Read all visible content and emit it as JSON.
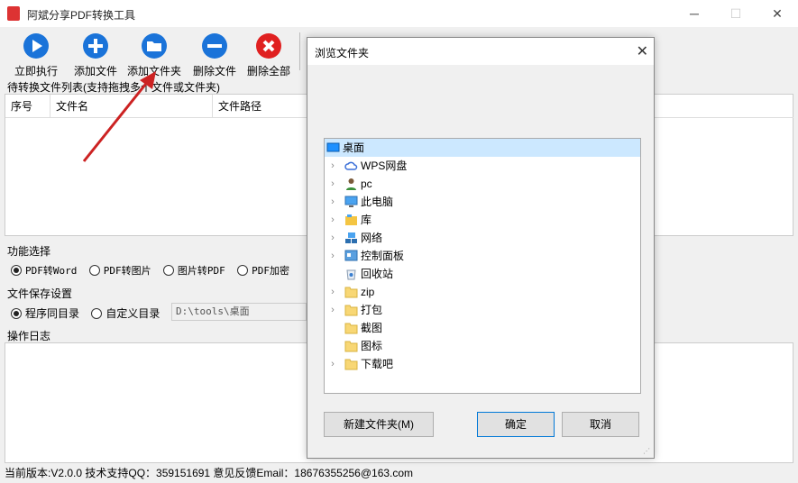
{
  "app": {
    "title": "阿斌分享PDF转换工具"
  },
  "toolbar": {
    "run": "立即执行",
    "add_file": "添加文件",
    "add_folder": "添加文件夹",
    "delete_file": "删除文件",
    "delete_all": "删除全部"
  },
  "file_list": {
    "label": "待转换文件列表(支持拖拽多个文件或文件夹)",
    "columns": [
      "序号",
      "文件名",
      "文件路径"
    ]
  },
  "function": {
    "label": "功能选择",
    "options": [
      "PDF转Word",
      "PDF转图片",
      "图片转PDF",
      "PDF加密"
    ],
    "selected": "PDF转Word"
  },
  "save": {
    "label": "文件保存设置",
    "options": [
      "程序同目录",
      "自定义目录"
    ],
    "selected": "程序同目录",
    "path": "D:\\tools\\桌面"
  },
  "log": {
    "label": "操作日志"
  },
  "status": {
    "text": "当前版本:V2.0.0  技术支持QQ：359151691  意见反馈Email：18676355256@163.com"
  },
  "dialog": {
    "title": "浏览文件夹",
    "tree": {
      "root": "桌面",
      "items": [
        "WPS网盘",
        "pc",
        "此电脑",
        "库",
        "网络",
        "控制面板",
        "回收站",
        "zip",
        "打包",
        "截图",
        "图标",
        "下载吧"
      ]
    },
    "new_folder": "新建文件夹(M)",
    "ok": "确定",
    "cancel": "取消"
  },
  "colors": {
    "run": "#1a73d9",
    "add": "#1a73d9",
    "delete": "#1a73d9",
    "delete_all": "#e02020",
    "arrow": "#cc2222"
  }
}
